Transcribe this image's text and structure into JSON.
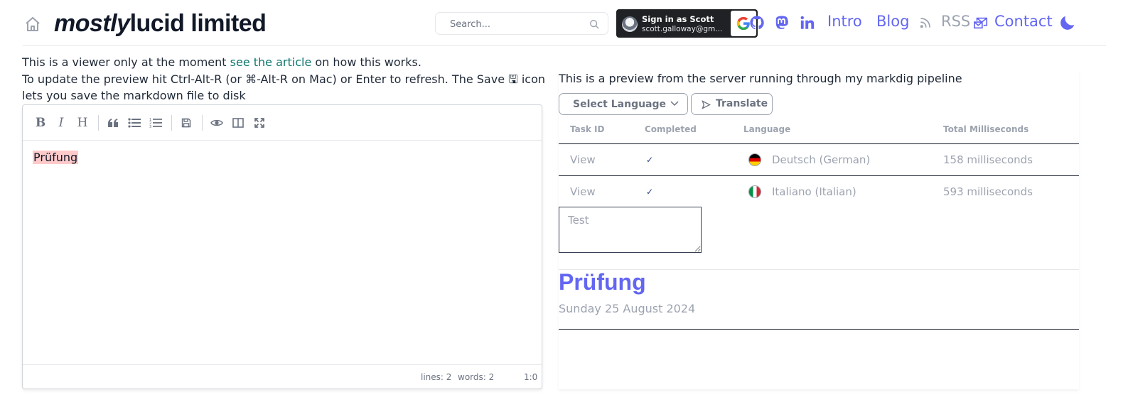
{
  "header": {
    "brand_italic": "mostly",
    "brand_rest": "lucid limited",
    "search_placeholder": "Search...",
    "google_signin": {
      "line1": "Sign in as Scott",
      "line2": "scott.galloway@gm..."
    },
    "nav": {
      "intro": "Intro",
      "blog": "Blog",
      "rss": "RSS",
      "contact": "Contact"
    },
    "icons": [
      "home-icon",
      "search-icon",
      "github-icon",
      "mastodon-icon",
      "linkedin-icon",
      "rss-icon",
      "mail-icon",
      "moon-icon"
    ]
  },
  "intro": {
    "line1_before": "This is a viewer only at the moment ",
    "line1_link": "see the article",
    "line1_after": " on how this works.",
    "line2": "To update the preview hit Ctrl-Alt-R (or ⌘-Alt-R on Mac) or Enter to refresh. The Save 🖫 icon lets you save the markdown file to disk"
  },
  "editor": {
    "content": "Prüfung",
    "toolbar": {
      "bold": "B",
      "italic": "I",
      "heading": "H"
    },
    "status": {
      "lines": "lines: 2",
      "words": "words: 2",
      "cursor": "1:0"
    }
  },
  "preview": {
    "description": "This is a preview from the server running through my markdig pipeline",
    "select_language": "Select Language",
    "translate": "Translate",
    "columns": [
      "Task ID",
      "Completed",
      "Language",
      "Total Milliseconds"
    ],
    "rows": [
      {
        "task": "View",
        "completed": "✓",
        "language": "Deutsch (German)",
        "ms": "158 milliseconds",
        "flag": "de"
      },
      {
        "task": "View",
        "completed": "✓",
        "language": "Italiano (Italian)",
        "ms": "593 milliseconds",
        "flag": "it"
      }
    ],
    "textarea_placeholder": "Test",
    "post_title": "Prüfung",
    "post_date": "Sunday 25 August 2024"
  },
  "colors": {
    "accent": "#6366f1",
    "link": "#0f766e",
    "highlight": "#fecaca"
  }
}
